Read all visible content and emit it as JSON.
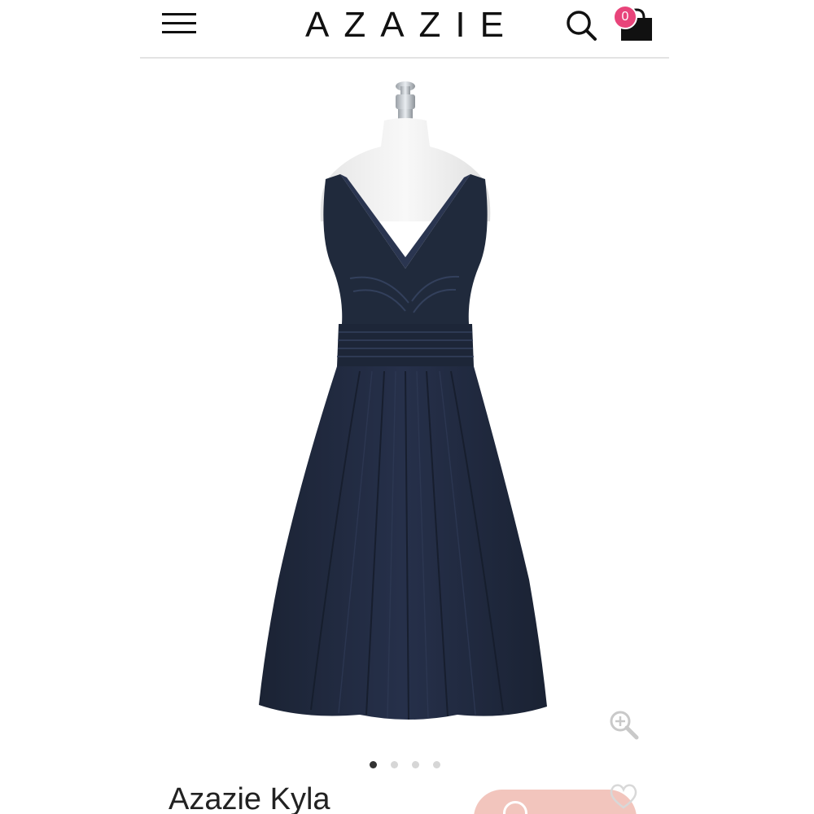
{
  "header": {
    "logo_text": "AZAZIE",
    "cart_count": "0",
    "menu_icon": "hamburger-menu-icon",
    "search_icon": "search-icon",
    "cart_icon": "shopping-bag-icon"
  },
  "product": {
    "title": "Azazie Kyla",
    "image_alt": "navy-v-neck-knee-length-dress-on-mannequin",
    "zoom_icon": "zoom-in-icon",
    "favorite_icon": "heart-icon"
  },
  "carousel": {
    "total_slides": 4,
    "active_slide": 1
  },
  "colors": {
    "dress": "#202a3c",
    "badge": "#e8447a",
    "accent_button": "#f2c5bd",
    "divider": "#e3e3e3"
  }
}
